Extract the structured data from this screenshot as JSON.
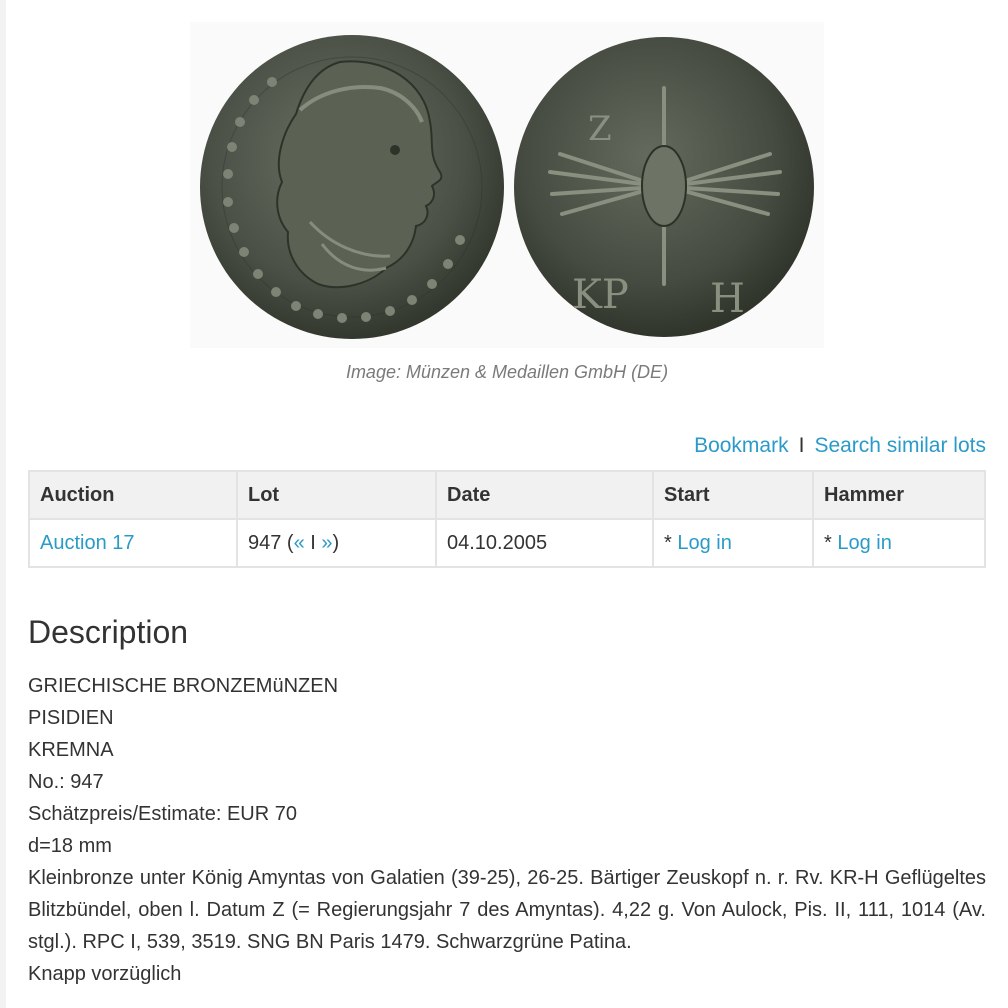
{
  "image": {
    "caption": "Image: Münzen & Medaillen GmbH (DE)",
    "reverse_legend": [
      "Z",
      "KP",
      "H"
    ]
  },
  "actions": {
    "bookmark": "Bookmark",
    "separator": "I",
    "search_similar": "Search similar lots"
  },
  "lot_table": {
    "headers": [
      "Auction",
      "Lot",
      "Date",
      "Start",
      "Hammer"
    ],
    "row": {
      "auction": "Auction 17",
      "lot_number": "947 (",
      "prev": "«",
      "lot_sep": " I ",
      "next": "»",
      "lot_close": ")",
      "date": "04.10.2005",
      "start_prefix": "* ",
      "start_link": "Log in",
      "hammer_prefix": "* ",
      "hammer_link": "Log in"
    }
  },
  "description": {
    "heading": "Description",
    "lines": [
      "GRIECHISCHE BRONZEMüNZEN",
      "PISIDIEN",
      "KREMNA",
      "No.: 947",
      "Schätzpreis/Estimate: EUR 70",
      "d=18 mm"
    ],
    "text": "Kleinbronze unter König Amyntas von Galatien (39-25), 26-25. Bärtiger Zeuskopf n. r. Rv. KR-H Geflügeltes Blitzbündel, oben l. Datum Z (= Regierungsjahr 7 des Amyntas). 4,22 g. Von Aulock, Pis. II, 111, 1014 (Av. stgl.). RPC I, 539, 3519. SNG BN Paris 1479. Schwarzgrüne Patina.",
    "grade": "Knapp vorzüglich"
  },
  "colors": {
    "link": "#2a9bc9",
    "table_header_bg": "#f1f1f1",
    "border": "#e3e3e3",
    "coin_patina": "#4d5347"
  },
  "icons": {
    "obverse": "coin-obverse-zeus-head",
    "reverse": "coin-reverse-thunderbolt"
  }
}
